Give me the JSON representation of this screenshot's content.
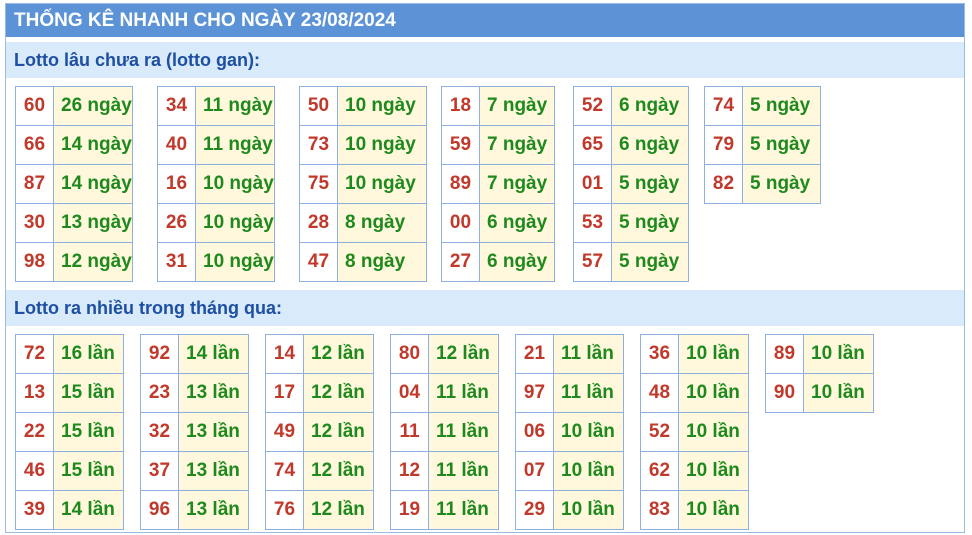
{
  "title": "THỐNG KÊ NHANH CHO NGÀY 23/08/2024",
  "gan": {
    "header": "Lotto lâu chưa ra (lotto gan):",
    "columns": [
      [
        {
          "num": "60",
          "count": "26 ngày"
        },
        {
          "num": "66",
          "count": "14 ngày"
        },
        {
          "num": "87",
          "count": "14 ngày"
        },
        {
          "num": "30",
          "count": "13 ngày"
        },
        {
          "num": "98",
          "count": "12 ngày"
        }
      ],
      [
        {
          "num": "34",
          "count": "11 ngày"
        },
        {
          "num": "40",
          "count": "11 ngày"
        },
        {
          "num": "16",
          "count": "10 ngày"
        },
        {
          "num": "26",
          "count": "10 ngày"
        },
        {
          "num": "31",
          "count": "10 ngày"
        }
      ],
      [
        {
          "num": "50",
          "count": "10 ngày"
        },
        {
          "num": "73",
          "count": "10 ngày"
        },
        {
          "num": "75",
          "count": "10 ngày"
        },
        {
          "num": "28",
          "count": "8 ngày"
        },
        {
          "num": "47",
          "count": "8 ngày"
        }
      ],
      [
        {
          "num": "18",
          "count": "7 ngày"
        },
        {
          "num": "59",
          "count": "7 ngày"
        },
        {
          "num": "89",
          "count": "7 ngày"
        },
        {
          "num": "00",
          "count": "6 ngày"
        },
        {
          "num": "27",
          "count": "6 ngày"
        }
      ],
      [
        {
          "num": "52",
          "count": "6 ngày"
        },
        {
          "num": "65",
          "count": "6 ngày"
        },
        {
          "num": "01",
          "count": "5 ngày"
        },
        {
          "num": "53",
          "count": "5 ngày"
        },
        {
          "num": "57",
          "count": "5 ngày"
        }
      ],
      [
        {
          "num": "74",
          "count": "5 ngày"
        },
        {
          "num": "79",
          "count": "5 ngày"
        },
        {
          "num": "82",
          "count": "5 ngày"
        }
      ]
    ]
  },
  "nhieu": {
    "header": "Lotto ra nhiều trong tháng qua:",
    "columns": [
      [
        {
          "num": "72",
          "count": "16 lần"
        },
        {
          "num": "13",
          "count": "15 lần"
        },
        {
          "num": "22",
          "count": "15 lần"
        },
        {
          "num": "46",
          "count": "15 lần"
        },
        {
          "num": "39",
          "count": "14 lần"
        }
      ],
      [
        {
          "num": "92",
          "count": "14 lần"
        },
        {
          "num": "23",
          "count": "13 lần"
        },
        {
          "num": "32",
          "count": "13 lần"
        },
        {
          "num": "37",
          "count": "13 lần"
        },
        {
          "num": "96",
          "count": "13 lần"
        }
      ],
      [
        {
          "num": "14",
          "count": "12 lần"
        },
        {
          "num": "17",
          "count": "12 lần"
        },
        {
          "num": "49",
          "count": "12 lần"
        },
        {
          "num": "74",
          "count": "12 lần"
        },
        {
          "num": "76",
          "count": "12 lần"
        }
      ],
      [
        {
          "num": "80",
          "count": "12 lần"
        },
        {
          "num": "04",
          "count": "11 lần"
        },
        {
          "num": "11",
          "count": "11 lần"
        },
        {
          "num": "12",
          "count": "11 lần"
        },
        {
          "num": "19",
          "count": "11 lần"
        }
      ],
      [
        {
          "num": "21",
          "count": "11 lần"
        },
        {
          "num": "97",
          "count": "11 lần"
        },
        {
          "num": "06",
          "count": "10 lần"
        },
        {
          "num": "07",
          "count": "10 lần"
        },
        {
          "num": "29",
          "count": "10 lần"
        }
      ],
      [
        {
          "num": "36",
          "count": "10 lần"
        },
        {
          "num": "48",
          "count": "10 lần"
        },
        {
          "num": "52",
          "count": "10 lần"
        },
        {
          "num": "62",
          "count": "10 lần"
        },
        {
          "num": "83",
          "count": "10 lần"
        }
      ],
      [
        {
          "num": "89",
          "count": "10 lần"
        },
        {
          "num": "90",
          "count": "10 lần"
        }
      ]
    ]
  },
  "colors": {
    "title_bg": "#5b93d6",
    "section_bg": "#d9eafb",
    "number_text": "#c0392b",
    "count_text": "#1e8a1e",
    "count_bg": "#fff8dc"
  }
}
